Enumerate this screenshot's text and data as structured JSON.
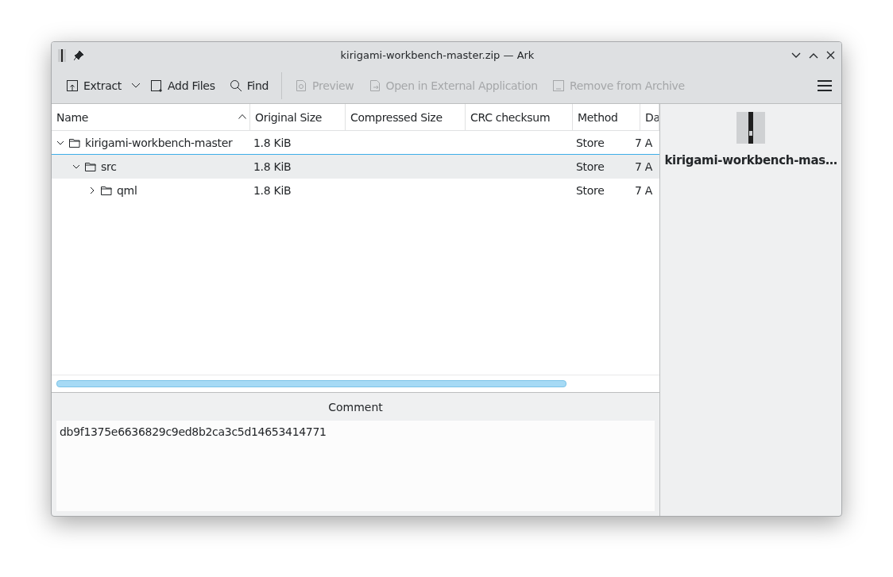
{
  "window": {
    "title": "kirigami-workbench-master.zip — Ark"
  },
  "toolbar": [
    {
      "label": "Extract",
      "kind": "extract",
      "disabled": false
    },
    {
      "label": "Add Files",
      "kind": "add",
      "disabled": false
    },
    {
      "label": "Find",
      "kind": "find",
      "disabled": false
    },
    {
      "label": "Preview",
      "kind": "preview",
      "disabled": true
    },
    {
      "label": "Open in External Application",
      "kind": "open",
      "disabled": true
    },
    {
      "label": "Remove from Archive",
      "kind": "remove",
      "disabled": true
    }
  ],
  "table": {
    "columns": [
      {
        "label": "Name",
        "sorted": true
      },
      {
        "label": "Original Size",
        "sorted": false
      },
      {
        "label": "Compressed Size",
        "sorted": false
      },
      {
        "label": "CRC checksum",
        "sorted": false
      },
      {
        "label": "Method",
        "sorted": false
      },
      {
        "label": "Da",
        "sorted": false
      }
    ],
    "rows": [
      {
        "name": "kirigami-workbench-master",
        "original_size": "1.8 KiB",
        "method": "Store",
        "date": "7 A",
        "expanded": true,
        "highlighted": false,
        "children": [
          {
            "name": "src",
            "original_size": "1.8 KiB",
            "method": "Store",
            "date": "7 A",
            "expanded": true,
            "highlighted": true,
            "children": [
              {
                "name": "qml",
                "original_size": "1.8 KiB",
                "method": "Store",
                "date": "7 A",
                "expanded": false,
                "highlighted": false
              }
            ]
          }
        ]
      }
    ]
  },
  "comment": {
    "title": "Comment",
    "value": "db9f1375e6636829c9ed8b2ca3c5d14653414771"
  },
  "details": {
    "name": "kirigami-workbench-mas…"
  }
}
